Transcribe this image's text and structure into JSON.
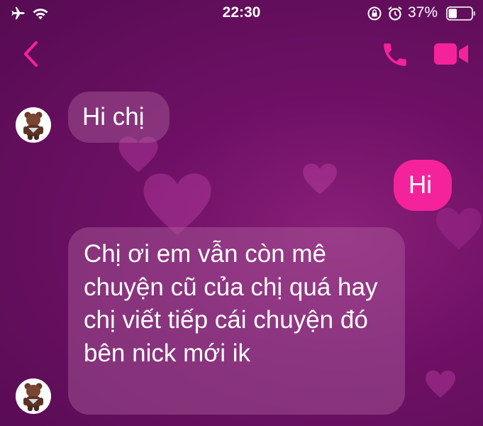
{
  "status_bar": {
    "time": "22:30",
    "battery_percent": "37%",
    "battery_level": 0.37,
    "icons": [
      "airplane-icon",
      "wifi-icon",
      "rotation-lock-icon",
      "alarm-icon",
      "battery-icon"
    ]
  },
  "nav": {
    "back_icon": "chevron-left-icon",
    "call_icon": "phone-icon",
    "video_icon": "video-camera-icon"
  },
  "colors": {
    "accent": "#f4239c",
    "background": "#6f1166",
    "incoming_bubble": "#8a3f82"
  },
  "messages": [
    {
      "sender": "other",
      "text": "Hi chị"
    },
    {
      "sender": "me",
      "text": "Hi"
    },
    {
      "sender": "other",
      "text": "Chị ơi em vẫn còn mê chuyện cũ của chị quá hay chị viết tiếp cái chuyện đó bên nick mới ik"
    }
  ]
}
